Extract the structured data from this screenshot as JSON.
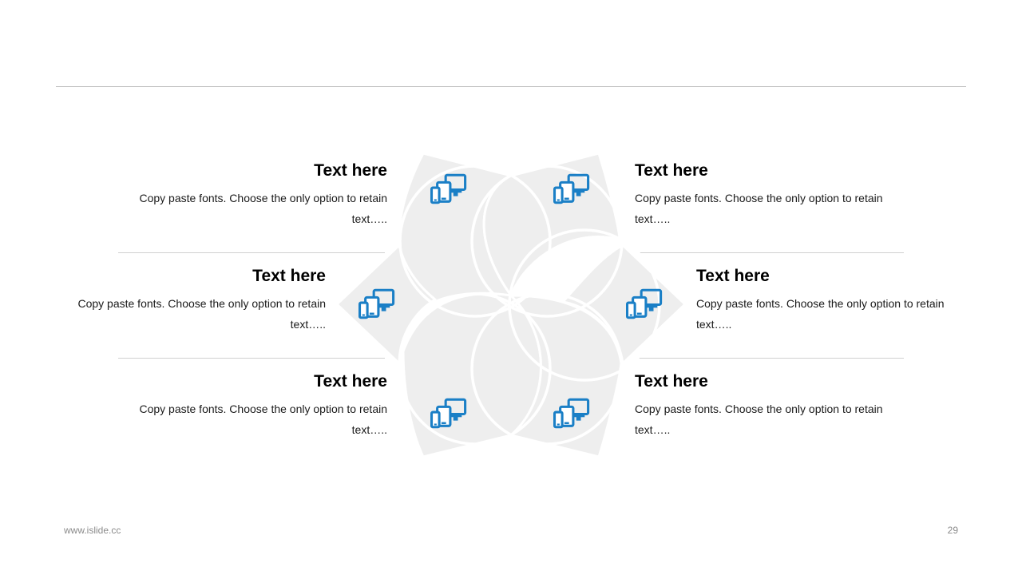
{
  "colors": {
    "accent": "#1a7fc6",
    "petal": "#eeeeee",
    "rule": "#bdbdbd",
    "footer_text": "#8a8a8a"
  },
  "items": [
    {
      "title": "Text here",
      "body": "Copy paste fonts. Choose the only option to retain text…..",
      "icon": "devices-icon"
    },
    {
      "title": "Text here",
      "body": "Copy paste fonts. Choose the only option to retain text…..",
      "icon": "devices-icon"
    },
    {
      "title": "Text here",
      "body": "Copy paste fonts. Choose the only option to retain text…..",
      "icon": "devices-icon"
    },
    {
      "title": "Text here",
      "body": "Copy paste fonts. Choose the only option to retain text…..",
      "icon": "devices-icon"
    },
    {
      "title": "Text here",
      "body": "Copy paste fonts. Choose the only option to retain text…..",
      "icon": "devices-icon"
    },
    {
      "title": "Text here",
      "body": "Copy paste fonts. Choose the only option to retain text…..",
      "icon": "devices-icon"
    }
  ],
  "footer": {
    "url": "www.islide.cc",
    "page_number": "29"
  }
}
